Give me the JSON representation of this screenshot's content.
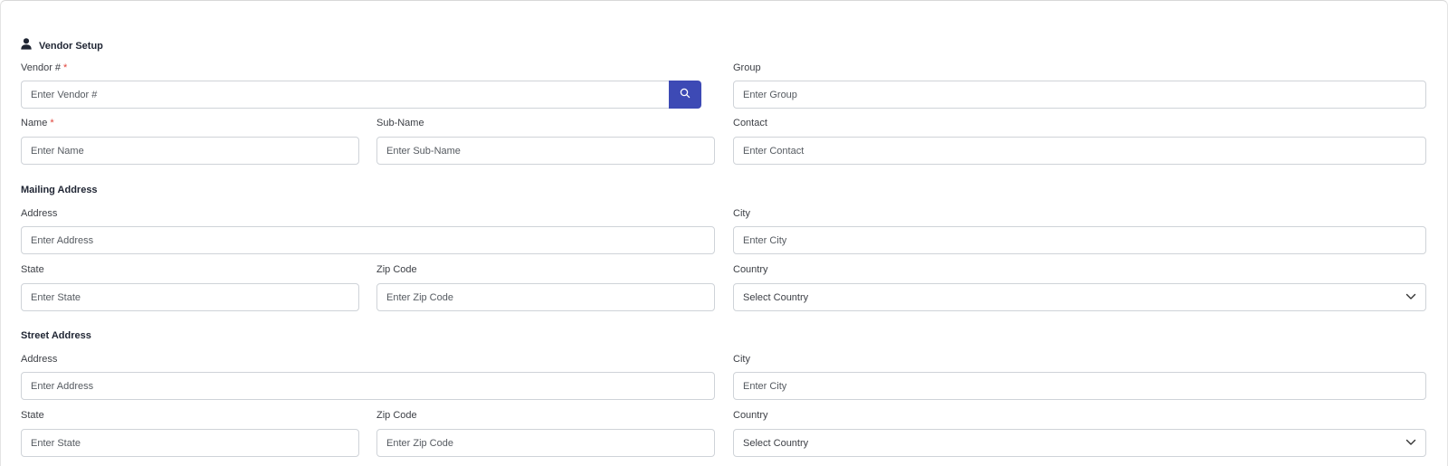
{
  "vendor_setup": {
    "title": "Vendor Setup",
    "vendor_no": {
      "label": "Vendor #",
      "required_mark": "*",
      "placeholder": "Enter Vendor #"
    },
    "group": {
      "label": "Group",
      "placeholder": "Enter Group"
    },
    "name": {
      "label": "Name",
      "required_mark": "*",
      "placeholder": "Enter Name"
    },
    "sub_name": {
      "label": "Sub-Name",
      "placeholder": "Enter Sub-Name"
    },
    "contact": {
      "label": "Contact",
      "placeholder": "Enter Contact"
    }
  },
  "mailing_address": {
    "title": "Mailing Address",
    "address": {
      "label": "Address",
      "placeholder": "Enter Address"
    },
    "city": {
      "label": "City",
      "placeholder": "Enter City"
    },
    "state": {
      "label": "State",
      "placeholder": "Enter State"
    },
    "zip": {
      "label": "Zip Code",
      "placeholder": "Enter Zip Code"
    },
    "country": {
      "label": "Country",
      "value": "Select Country"
    }
  },
  "street_address": {
    "title": "Street Address",
    "address": {
      "label": "Address",
      "placeholder": "Enter Address"
    },
    "city": {
      "label": "City",
      "placeholder": "Enter City"
    },
    "state": {
      "label": "State",
      "placeholder": "Enter State"
    },
    "zip": {
      "label": "Zip Code",
      "placeholder": "Enter Zip Code"
    },
    "country": {
      "label": "Country",
      "value": "Select Country"
    }
  },
  "icons": {
    "section": "user-icon",
    "search": "search-icon",
    "dropdown": "chevron-down-icon"
  },
  "colors": {
    "accent": "#3d4ab5",
    "required": "#e0433a"
  }
}
